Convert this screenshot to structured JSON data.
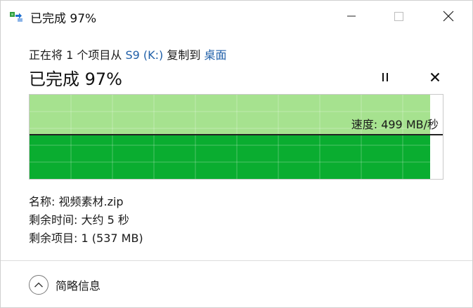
{
  "window": {
    "title": "已完成 97%",
    "icon": "file-copy-icon",
    "controls": {
      "minimize": "minimize-icon",
      "maximize": "maximize-icon",
      "close": "close-icon"
    }
  },
  "operation": {
    "prefix": "正在将 1 个项目从 ",
    "source": "S9 (K:)",
    "middle": " 复制到 ",
    "destination": "桌面"
  },
  "status": {
    "headline": "已完成 97%",
    "percent_complete": 97,
    "pause_icon": "pause-icon",
    "cancel_icon": "cancel-icon"
  },
  "graph": {
    "speed_label": "速度: 499 MB/秒",
    "fill_colors": {
      "upper": "#a6e28f",
      "lower": "#0aad30"
    }
  },
  "details": {
    "name_label": "名称:",
    "name_value": "视频素材.zip",
    "time_label": "剩余时间:",
    "time_value": "大约 5 秒",
    "items_label": "剩余项目:",
    "items_value": "1 (537 MB)"
  },
  "footer": {
    "toggle_icon": "chevron-up-icon",
    "toggle_label": "简略信息"
  },
  "colors": {
    "link": "#1f5fa8",
    "progress": "#0aad30"
  }
}
